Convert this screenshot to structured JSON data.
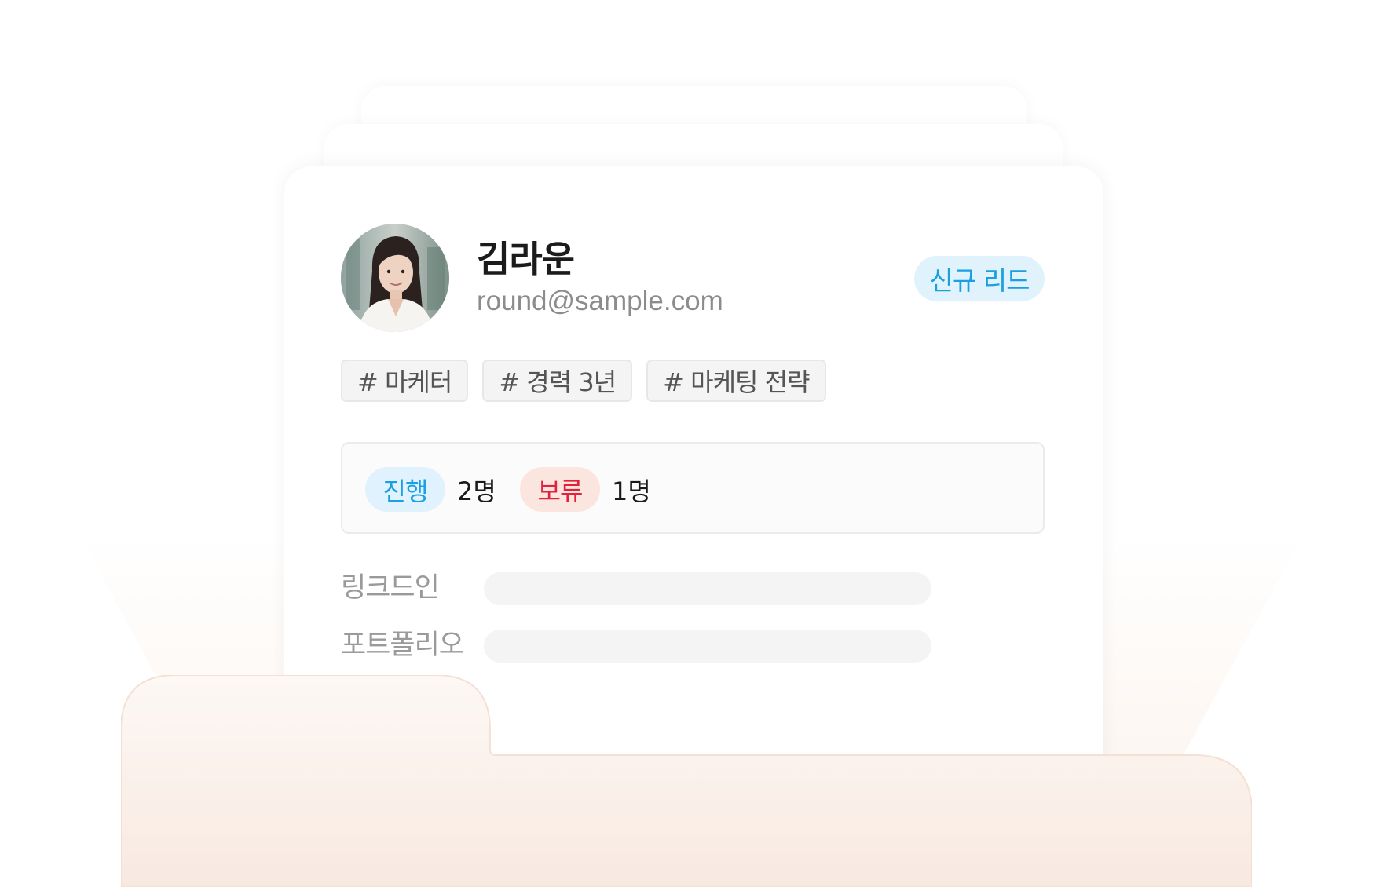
{
  "profile": {
    "name": "김라운",
    "email": "round@sample.com",
    "status_badge": "신규 리드"
  },
  "tags": [
    "# 마케터",
    "# 경력 3년",
    "# 마케팅 전략"
  ],
  "status_summary": {
    "progress_label": "진행",
    "progress_count": "2명",
    "hold_label": "보류",
    "hold_count": "1명"
  },
  "fields": {
    "linkedin_label": "링크드인",
    "portfolio_label": "포트폴리오"
  },
  "colors": {
    "accent_blue": "#1aa0e2",
    "accent_red": "#e2213c",
    "folder_tint": "#fbeee6"
  },
  "icons": {
    "avatar": "person-photo"
  }
}
